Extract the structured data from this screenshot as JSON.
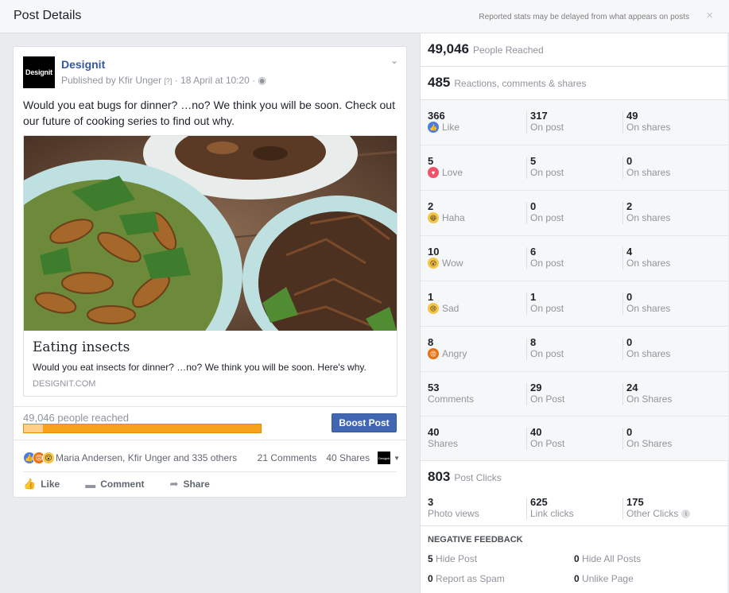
{
  "header": {
    "title": "Post Details",
    "note": "Reported stats may be delayed from what appears on posts",
    "close": "×"
  },
  "post": {
    "page_name": "Designit",
    "logo_text": "Designit",
    "published_by": "Published by Kfir Unger",
    "help": "[?]",
    "date": "· 18 April at 10:20 ·",
    "text": "Would you eat bugs for dinner? …no? We think you will be soon. Check out our future of cooking series to find out why.",
    "link_title": "Eating insects",
    "link_desc": "Would you eat insects for dinner? …no? We think you will be soon. Here's why.",
    "link_domain": "DESIGNIT.COM",
    "reached": "49,046 people reached",
    "reach_fill": 0.08,
    "boost": "Boost Post",
    "reactions_names": "Maria Andersen, Kfir Unger and 335 others",
    "comments": "21 Comments",
    "shares": "40 Shares",
    "actions": {
      "like": "Like",
      "comment": "Comment",
      "share": "Share"
    }
  },
  "stats": {
    "reached": {
      "value": "49,046",
      "label": "People Reached"
    },
    "engagement": {
      "value": "485",
      "label": "Reactions, comments & shares"
    },
    "rows": [
      {
        "total": "366",
        "label": "Like",
        "icon": "like-icon",
        "on_post": "317",
        "on_post_label": "On post",
        "on_shares": "49",
        "on_shares_label": "On shares"
      },
      {
        "total": "5",
        "label": "Love",
        "icon": "love-icon",
        "on_post": "5",
        "on_post_label": "On post",
        "on_shares": "0",
        "on_shares_label": "On shares"
      },
      {
        "total": "2",
        "label": "Haha",
        "icon": "haha-icon",
        "on_post": "0",
        "on_post_label": "On post",
        "on_shares": "2",
        "on_shares_label": "On shares"
      },
      {
        "total": "10",
        "label": "Wow",
        "icon": "wow-icon",
        "on_post": "6",
        "on_post_label": "On post",
        "on_shares": "4",
        "on_shares_label": "On shares"
      },
      {
        "total": "1",
        "label": "Sad",
        "icon": "sad-icon",
        "on_post": "1",
        "on_post_label": "On post",
        "on_shares": "0",
        "on_shares_label": "On shares"
      },
      {
        "total": "8",
        "label": "Angry",
        "icon": "angry-icon",
        "on_post": "8",
        "on_post_label": "On post",
        "on_shares": "0",
        "on_shares_label": "On shares"
      },
      {
        "total": "53",
        "label": "Comments",
        "icon": "",
        "on_post": "29",
        "on_post_label": "On Post",
        "on_shares": "24",
        "on_shares_label": "On Shares"
      },
      {
        "total": "40",
        "label": "Shares",
        "icon": "",
        "on_post": "40",
        "on_post_label": "On Post",
        "on_shares": "0",
        "on_shares_label": "On Shares"
      }
    ],
    "clicks": {
      "value": "803",
      "label": "Post Clicks"
    },
    "click_breakdown": [
      {
        "value": "3",
        "label": "Photo views"
      },
      {
        "value": "625",
        "label": "Link clicks"
      },
      {
        "value": "175",
        "label": "Other Clicks"
      }
    ],
    "negative": {
      "title": "NEGATIVE FEEDBACK",
      "hide_post": {
        "value": "5",
        "label": "Hide Post"
      },
      "hide_all": {
        "value": "0",
        "label": "Hide All Posts"
      },
      "spam": {
        "value": "0",
        "label": "Report as Spam"
      },
      "unlike": {
        "value": "0",
        "label": "Unlike Page"
      }
    }
  },
  "colors": {
    "accent": "#4267b2",
    "link": "#365899",
    "progress": "#f7a21b"
  }
}
